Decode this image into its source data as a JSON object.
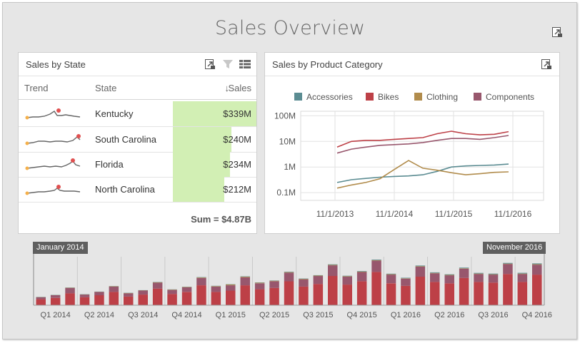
{
  "dashboard": {
    "title": "Sales Overview"
  },
  "state_panel": {
    "title": "Sales by State",
    "columns": {
      "trend": "Trend",
      "state": "State",
      "sales": "Sales",
      "sort_arrow": "↓"
    },
    "rows": [
      {
        "state": "Kentucky",
        "value": "$339M",
        "share": 1.0
      },
      {
        "state": "South Carolina",
        "value": "$240M",
        "share": 0.7
      },
      {
        "state": "Florida",
        "value": "$234M",
        "share": 0.68
      },
      {
        "state": "North Carolina",
        "value": "$212M",
        "share": 0.61
      }
    ],
    "sum_label": "Sum",
    "sum_value": "$4.87B",
    "sum_text": "Sum = $4.87B"
  },
  "category_panel": {
    "title": "Sales by Product Category"
  },
  "range": {
    "start_label": "January 2014",
    "end_label": "November 2016"
  },
  "colors": {
    "accessories": "#5b8c92",
    "bikes": "#bd4047",
    "clothing": "#b18c4c",
    "components": "#98576d",
    "bar_fill": "#d2efb4",
    "frame_bg": "#e6e6e6"
  },
  "chart_data": [
    {
      "type": "line",
      "title": "",
      "legend": [
        "Accessories",
        "Bikes",
        "Clothing",
        "Components"
      ],
      "legend_position": "top",
      "y_scale": "log",
      "y_ticks": [
        "0.1M",
        "1M",
        "10M",
        "100M"
      ],
      "ylim": [
        50000,
        150000000
      ],
      "x_ticks": [
        "11/1/2013",
        "11/1/2014",
        "11/1/2015",
        "11/1/2016"
      ],
      "x": [
        "2013-12",
        "2014-03",
        "2014-06",
        "2014-09",
        "2014-12",
        "2015-03",
        "2015-06",
        "2015-09",
        "2015-12",
        "2016-03",
        "2016-06",
        "2016-09",
        "2016-11"
      ],
      "series": [
        {
          "name": "Accessories",
          "values": [
            0.25,
            0.32,
            0.36,
            0.4,
            0.43,
            0.45,
            0.5,
            0.68,
            1.0,
            1.1,
            1.15,
            1.2,
            1.3
          ]
        },
        {
          "name": "Bikes",
          "values": [
            6,
            10,
            11,
            11,
            12,
            13,
            14,
            20,
            25,
            20,
            18,
            19,
            24
          ]
        },
        {
          "name": "Clothing",
          "values": [
            0.15,
            0.2,
            0.25,
            0.35,
            0.8,
            1.8,
            0.9,
            0.75,
            0.6,
            0.5,
            0.55,
            0.62,
            0.65
          ]
        },
        {
          "name": "Components",
          "values": [
            3.5,
            5,
            6,
            7,
            7.5,
            8,
            9,
            11,
            13,
            13,
            12,
            14,
            17
          ]
        }
      ],
      "grid": true
    },
    {
      "type": "bar",
      "stacked": true,
      "title": "",
      "x_ticks": [
        "Q1 2014",
        "Q2 2014",
        "Q3 2014",
        "Q4 2014",
        "Q1 2015",
        "Q2 2015",
        "Q3 2015",
        "Q4 2015",
        "Q1 2016",
        "Q2 2016",
        "Q3 2016",
        "Q4 2016"
      ],
      "categories": [
        "2014-01",
        "2014-02",
        "2014-03",
        "2014-04",
        "2014-05",
        "2014-06",
        "2014-07",
        "2014-08",
        "2014-09",
        "2014-10",
        "2014-11",
        "2014-12",
        "2015-01",
        "2015-02",
        "2015-03",
        "2015-04",
        "2015-05",
        "2015-06",
        "2015-07",
        "2015-08",
        "2015-09",
        "2015-10",
        "2015-11",
        "2015-12",
        "2016-01",
        "2016-02",
        "2016-03",
        "2016-04",
        "2016-05",
        "2016-06",
        "2016-07",
        "2016-08",
        "2016-09",
        "2016-10",
        "2016-11"
      ],
      "series": [
        {
          "name": "Bikes",
          "values": [
            9,
            11,
            18,
            12,
            15,
            20,
            13,
            16,
            25,
            17,
            20,
            30,
            20,
            22,
            30,
            24,
            26,
            36,
            28,
            32,
            44,
            31,
            36,
            50,
            33,
            29,
            43,
            35,
            33,
            41,
            35,
            34,
            47,
            35,
            46
          ]
        },
        {
          "name": "Components",
          "values": [
            3,
            4,
            8,
            4,
            5,
            8,
            5,
            6,
            9,
            6,
            7,
            11,
            8,
            8,
            12,
            9,
            10,
            13,
            11,
            12,
            16,
            12,
            14,
            17,
            13,
            11,
            15,
            13,
            12,
            14,
            12,
            12,
            15,
            12,
            15
          ]
        },
        {
          "name": "Clothing",
          "values": [
            0.3,
            0.3,
            0.4,
            0.3,
            0.3,
            0.5,
            0.4,
            0.4,
            0.6,
            0.5,
            0.5,
            0.8,
            0.8,
            1.2,
            1.0,
            0.8,
            0.8,
            0.8,
            0.7,
            0.7,
            0.8,
            0.7,
            0.7,
            0.8,
            0.6,
            0.5,
            0.7,
            0.6,
            0.6,
            0.6,
            0.6,
            0.6,
            0.6,
            0.6,
            0.7
          ]
        },
        {
          "name": "Accessories",
          "values": [
            0.2,
            0.2,
            0.3,
            0.2,
            0.2,
            0.3,
            0.3,
            0.3,
            0.4,
            0.3,
            0.3,
            0.5,
            0.4,
            0.4,
            0.5,
            0.4,
            0.4,
            0.6,
            0.5,
            0.5,
            0.7,
            0.6,
            0.7,
            0.9,
            0.8,
            0.8,
            1.0,
            0.9,
            0.9,
            1.0,
            1.0,
            1.0,
            1.1,
            1.1,
            1.2
          ]
        }
      ],
      "grid": false
    }
  ]
}
